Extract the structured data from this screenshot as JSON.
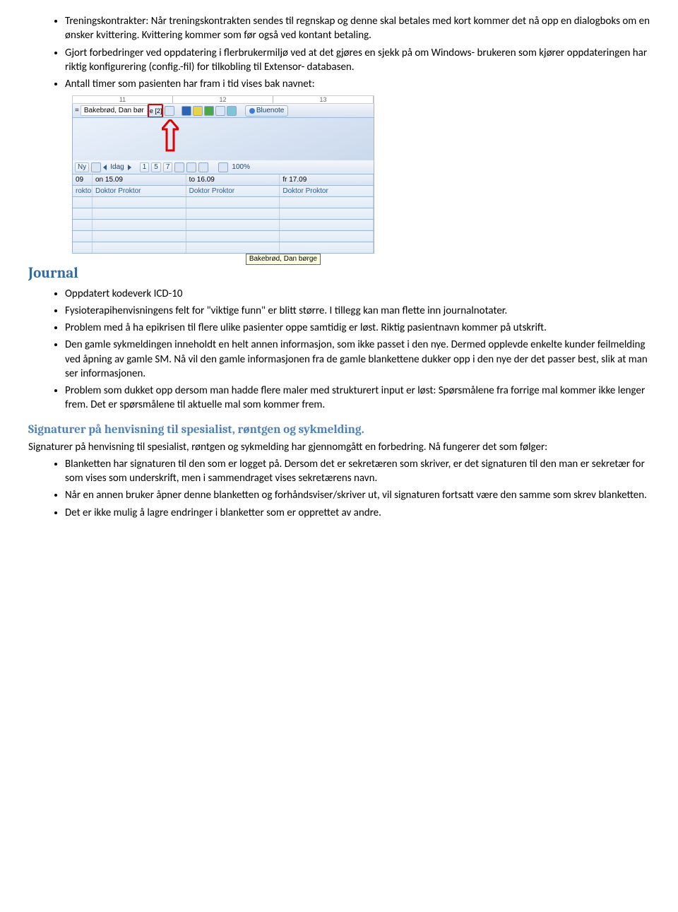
{
  "section1": {
    "items": [
      "Treningskontrakter: Når treningskontrakten sendes til regnskap og denne skal betales med kort kommer det nå opp en dialogboks om en ønsker kvittering. Kvittering kommer som før også ved kontant betaling.",
      "Gjort forbedringer ved oppdatering i flerbrukermiljø ved at det gjøres en sjekk på om Windows- brukeren som kjører oppdateringen har riktig konfigurering (config.-fil) for tilkobling til Extensor- databasen.",
      "Antall timer som pasienten har fram i tid vises bak navnet:"
    ]
  },
  "app": {
    "ruler": [
      "11",
      "12",
      "13"
    ],
    "patient_prefix": "=",
    "patient_name": "Bakebrød, Dan bør",
    "patient_suffix": "e  [2]",
    "bluenote_label": "Bluenote",
    "toolbar2": {
      "ny": "Ny",
      "idag": "Idag",
      "nums": [
        "1",
        "5",
        "7"
      ],
      "zoom": "100%"
    },
    "sched_head": [
      "09",
      "on 15.09",
      "to 16.09",
      "fr 17.09"
    ],
    "sched_row1": [
      "roktor",
      "Doktor Proktor",
      "Doktor Proktor",
      "Doktor Proktor"
    ],
    "tooltip": "Bakebrød, Dan børge"
  },
  "journal": {
    "heading": "Journal",
    "items": [
      "Oppdatert kodeverk ICD-10",
      "Fysioterapihenvisningens felt for \"viktige funn\" er blitt større. I tillegg kan man flette inn journalnotater.",
      "Problem med å ha epikrisen til flere ulike pasienter oppe samtidig er løst. Riktig pasientnavn kommer på utskrift.",
      "Den gamle sykmeldingen inneholdt en helt annen informasjon, som ikke passet i den nye. Dermed opplevde enkelte kunder feilmelding ved åpning av gamle SM. Nå vil den gamle informasjonen fra de gamle blankettene dukker opp i den nye der det passer best, slik at man ser informasjonen.",
      "Problem som dukket opp dersom man hadde flere maler med strukturert input er løst: Spørsmålene fra forrige mal kommer ikke lenger frem. Det er spørsmålene til aktuelle mal som kommer frem."
    ]
  },
  "signaturer": {
    "heading": "Signaturer på henvisning til spesialist, røntgen og sykmelding.",
    "intro": "Signaturer på henvisning til spesialist, røntgen og sykmelding har gjennomgått en forbedring. Nå fungerer det som følger:",
    "items": [
      "Blanketten har signaturen til den som er logget på. Dersom det er sekretæren som skriver, er det signaturen til den man er sekretær for som vises som underskrift, men i sammendraget vises sekretærens navn.",
      "Når en annen bruker åpner denne blanketten og forhåndsviser/skriver ut, vil signaturen fortsatt være den samme som skrev blanketten.",
      "Det er ikke mulig å lagre endringer i blanketter som er opprettet av andre."
    ]
  }
}
